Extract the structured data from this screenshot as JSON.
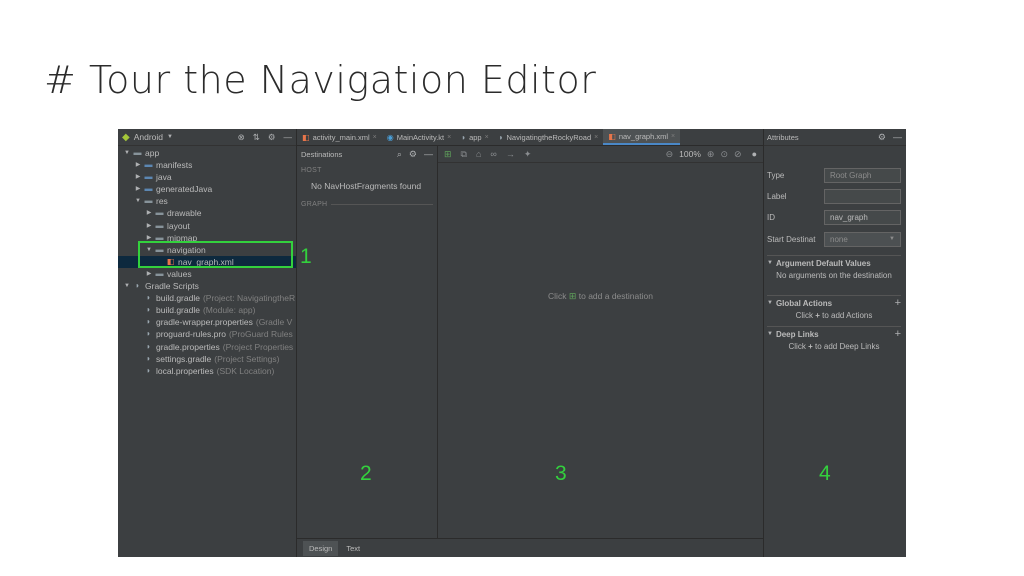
{
  "slide": {
    "title": "# Tour the Navigation Editor"
  },
  "project_panel": {
    "view_mode": "Android",
    "icons": [
      "android-icon",
      "chevron-down-icon",
      "collapse-icon",
      "settings-icon",
      "hide-icon"
    ],
    "tree": [
      {
        "label": "app",
        "hint": "",
        "arrow": "▼",
        "icon": "folder",
        "indent": 0,
        "selected": false
      },
      {
        "label": "manifests",
        "hint": "",
        "arrow": "▶",
        "icon": "folder-blue",
        "indent": 1,
        "selected": false
      },
      {
        "label": "java",
        "hint": "",
        "arrow": "▶",
        "icon": "folder-blue",
        "indent": 1,
        "selected": false
      },
      {
        "label": "generatedJava",
        "hint": "",
        "arrow": "▶",
        "icon": "folder-blue",
        "indent": 1,
        "selected": false
      },
      {
        "label": "res",
        "hint": "",
        "arrow": "▼",
        "icon": "folder",
        "indent": 1,
        "selected": false
      },
      {
        "label": "drawable",
        "hint": "",
        "arrow": "▶",
        "icon": "folder",
        "indent": 2,
        "selected": false
      },
      {
        "label": "layout",
        "hint": "",
        "arrow": "▶",
        "icon": "folder",
        "indent": 2,
        "selected": false
      },
      {
        "label": "mipmap",
        "hint": "",
        "arrow": "▶",
        "icon": "folder",
        "indent": 2,
        "selected": false
      },
      {
        "label": "navigation",
        "hint": "",
        "arrow": "▼",
        "icon": "folder",
        "indent": 2,
        "selected": false
      },
      {
        "label": "nav_graph.xml",
        "hint": "",
        "arrow": "",
        "icon": "xml",
        "indent": 3,
        "selected": true
      },
      {
        "label": "values",
        "hint": "",
        "arrow": "▶",
        "icon": "folder",
        "indent": 2,
        "selected": false
      },
      {
        "label": "Gradle Scripts",
        "hint": "",
        "arrow": "▼",
        "icon": "gradle",
        "indent": 0,
        "selected": false
      },
      {
        "label": "build.gradle",
        "hint": "(Project: NavigatingtheR",
        "arrow": "",
        "icon": "gradle",
        "indent": 1,
        "selected": false
      },
      {
        "label": "build.gradle",
        "hint": "(Module: app)",
        "arrow": "",
        "icon": "gradle",
        "indent": 1,
        "selected": false
      },
      {
        "label": "gradle-wrapper.properties",
        "hint": "(Gradle V",
        "arrow": "",
        "icon": "gradle",
        "indent": 1,
        "selected": false
      },
      {
        "label": "proguard-rules.pro",
        "hint": "(ProGuard Rules",
        "arrow": "",
        "icon": "gradle",
        "indent": 1,
        "selected": false
      },
      {
        "label": "gradle.properties",
        "hint": "(Project Properties",
        "arrow": "",
        "icon": "gradle",
        "indent": 1,
        "selected": false
      },
      {
        "label": "settings.gradle",
        "hint": "(Project Settings)",
        "arrow": "",
        "icon": "gradle",
        "indent": 1,
        "selected": false
      },
      {
        "label": "local.properties",
        "hint": "(SDK Location)",
        "arrow": "",
        "icon": "gradle",
        "indent": 1,
        "selected": false
      }
    ]
  },
  "editor": {
    "tabs": [
      {
        "label": "activity_main.xml",
        "icon": "xml-file-icon",
        "active": false
      },
      {
        "label": "MainActivity.kt",
        "icon": "kotlin-file-icon",
        "active": false
      },
      {
        "label": "app",
        "icon": "gradle-icon",
        "active": false
      },
      {
        "label": "NavigatingtheRockyRoad",
        "icon": "gradle-icon",
        "active": false
      },
      {
        "label": "nav_graph.xml",
        "icon": "nav-xml-icon",
        "active": true
      }
    ],
    "destinations": {
      "title": "Destinations",
      "host_label": "HOST",
      "host_empty": "No NavHostFragments found",
      "graph_label": "GRAPH"
    },
    "canvas": {
      "zoom": "100%",
      "empty_prefix": "Click",
      "empty_suffix": "to add a destination"
    },
    "bottom_tabs": [
      {
        "label": "Design",
        "active": true
      },
      {
        "label": "Text",
        "active": false
      }
    ]
  },
  "attributes": {
    "title": "Attributes",
    "fields": {
      "type": {
        "label": "Type",
        "value": "Root Graph"
      },
      "label": {
        "label": "Label",
        "value": ""
      },
      "id": {
        "label": "ID",
        "value": "nav_graph"
      },
      "start": {
        "label": "Start Destinat",
        "value": "none"
      }
    },
    "sections": {
      "args": {
        "title": "Argument Default Values",
        "body": "No arguments on the destination"
      },
      "actions": {
        "title": "Global Actions",
        "body_prefix": "Click",
        "plus": "+",
        "body_suffix": "to add Actions"
      },
      "links": {
        "title": "Deep Links",
        "body_prefix": "Click",
        "plus": "+",
        "body_suffix": "to add Deep Links"
      }
    }
  },
  "callouts": {
    "one": "1",
    "two": "2",
    "three": "3",
    "four": "4"
  },
  "colors": {
    "callout_green": "#33d13d",
    "ide_bg": "#3c3f41",
    "selection": "#0d293e",
    "active_tab_underline": "#4a88c7"
  }
}
